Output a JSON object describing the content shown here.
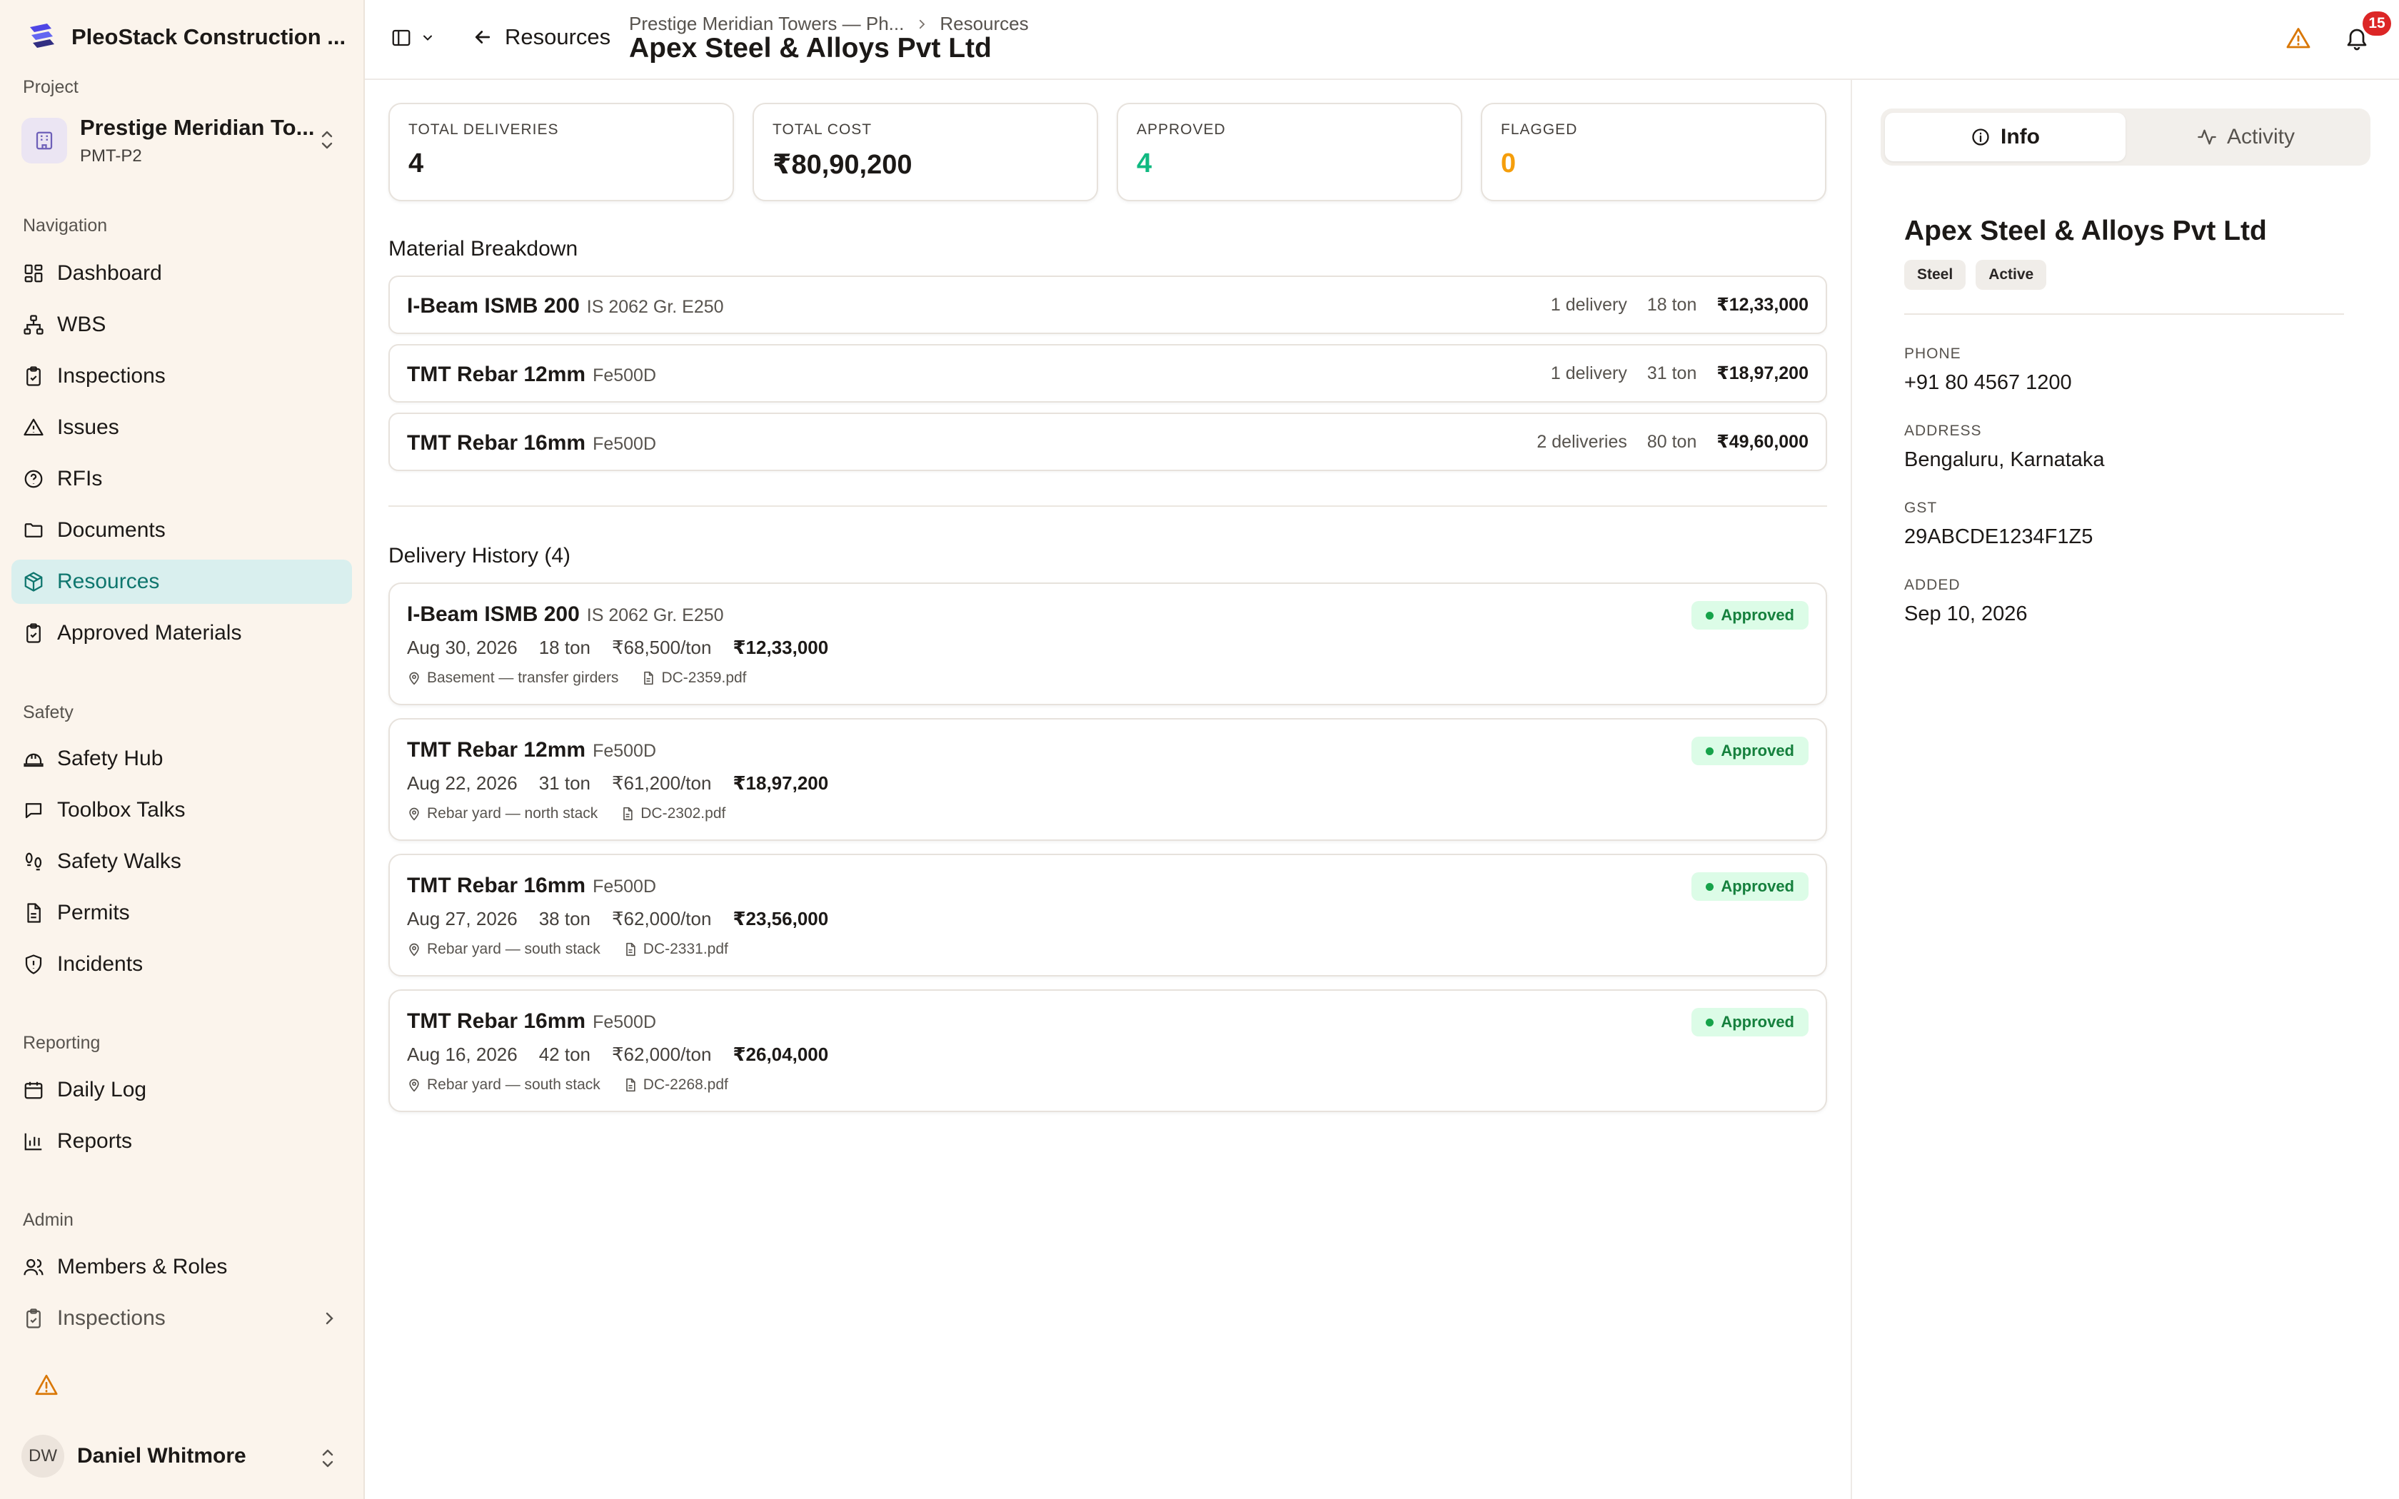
{
  "app": {
    "name": "PleoStack Construction ..."
  },
  "sidebar": {
    "project_label": "Project",
    "project": {
      "name": "Prestige Meridian To...",
      "code": "PMT-P2"
    },
    "sections": {
      "navigation": "Navigation",
      "safety": "Safety",
      "reporting": "Reporting",
      "admin": "Admin"
    },
    "nav": {
      "dashboard": "Dashboard",
      "wbs": "WBS",
      "inspections": "Inspections",
      "issues": "Issues",
      "rfis": "RFIs",
      "documents": "Documents",
      "resources": "Resources",
      "approved_materials": "Approved Materials",
      "safety_hub": "Safety Hub",
      "toolbox_talks": "Toolbox Talks",
      "safety_walks": "Safety Walks",
      "permits": "Permits",
      "incidents": "Incidents",
      "daily_log": "Daily Log",
      "reports": "Reports",
      "members_roles": "Members & Roles",
      "admin_inspections": "Inspections"
    },
    "active_item": "Resources",
    "user": {
      "initials": "DW",
      "name": "Daniel Whitmore"
    }
  },
  "header": {
    "back_label": "Resources",
    "breadcrumb": [
      "Prestige Meridian Towers — Ph...",
      "Resources"
    ],
    "title": "Apex Steel & Alloys Pvt Ltd",
    "notification_count": "15"
  },
  "stats": [
    {
      "label": "TOTAL DELIVERIES",
      "value": "4"
    },
    {
      "label": "TOTAL COST",
      "value": "₹80,90,200"
    },
    {
      "label": "APPROVED",
      "value": "4"
    },
    {
      "label": "FLAGGED",
      "value": "0"
    }
  ],
  "material_breakdown": {
    "title": "Material Breakdown",
    "rows": [
      {
        "name": "I-Beam ISMB 200",
        "spec": "IS 2062 Gr. E250",
        "deliveries": "1 delivery",
        "qty": "18 ton",
        "amount": "₹12,33,000"
      },
      {
        "name": "TMT Rebar 12mm",
        "spec": "Fe500D",
        "deliveries": "1 delivery",
        "qty": "31 ton",
        "amount": "₹18,97,200"
      },
      {
        "name": "TMT Rebar 16mm",
        "spec": "Fe500D",
        "deliveries": "2 deliveries",
        "qty": "80 ton",
        "amount": "₹49,60,000"
      }
    ]
  },
  "delivery_history": {
    "title": "Delivery History (4)",
    "items": [
      {
        "name": "I-Beam ISMB 200",
        "spec": "IS 2062 Gr. E250",
        "date": "Aug 30, 2026",
        "qty": "18 ton",
        "rate": "₹68,500/ton",
        "amount": "₹12,33,000",
        "location": "Basement — transfer girders",
        "doc": "DC-2359.pdf",
        "status": "Approved"
      },
      {
        "name": "TMT Rebar 12mm",
        "spec": "Fe500D",
        "date": "Aug 22, 2026",
        "qty": "31 ton",
        "rate": "₹61,200/ton",
        "amount": "₹18,97,200",
        "location": "Rebar yard — north stack",
        "doc": "DC-2302.pdf",
        "status": "Approved"
      },
      {
        "name": "TMT Rebar 16mm",
        "spec": "Fe500D",
        "date": "Aug 27, 2026",
        "qty": "38 ton",
        "rate": "₹62,000/ton",
        "amount": "₹23,56,000",
        "location": "Rebar yard — south stack",
        "doc": "DC-2331.pdf",
        "status": "Approved"
      },
      {
        "name": "TMT Rebar 16mm",
        "spec": "Fe500D",
        "date": "Aug 16, 2026",
        "qty": "42 ton",
        "rate": "₹62,000/ton",
        "amount": "₹26,04,000",
        "location": "Rebar yard — south stack",
        "doc": "DC-2268.pdf",
        "status": "Approved"
      }
    ]
  },
  "panel": {
    "tabs": [
      "Info",
      "Activity"
    ],
    "active_tab": "Info",
    "vendor_name": "Apex Steel & Alloys Pvt Ltd",
    "chips": [
      "Steel",
      "Active"
    ],
    "fields": [
      {
        "label": "PHONE",
        "value": "+91 80 4567 1200"
      },
      {
        "label": "ADDRESS",
        "value": "Bengaluru, Karnataka"
      },
      {
        "label": "GST",
        "value": "29ABCDE1234F1Z5"
      },
      {
        "label": "ADDED",
        "value": "Sep 10, 2026"
      }
    ]
  },
  "colors": {
    "accent": "#0f766e",
    "active_bg": "#d9efee",
    "approved": "#10b981",
    "flagged": "#f59e0b",
    "sidebar_bg": "#fbf4ec",
    "badge": "#dc2626"
  },
  "icons": {
    "brand": "stack-logo-icon",
    "warning": "warning-triangle-icon",
    "bell": "bell-icon",
    "back": "arrow-left-icon",
    "sidebar_toggle": "panel-left-icon"
  }
}
